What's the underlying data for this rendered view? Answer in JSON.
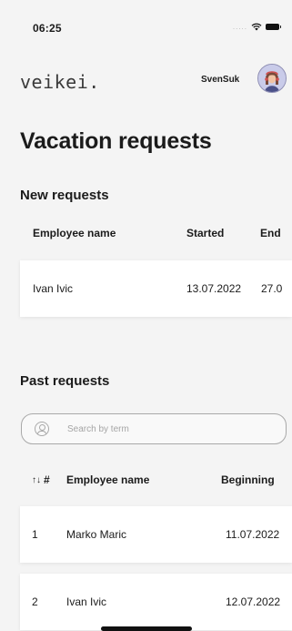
{
  "status_bar": {
    "time": "06:25",
    "signal": "....."
  },
  "header": {
    "logo": "veikei.",
    "username": "SvenSuk"
  },
  "page_title": "Vacation requests",
  "new_requests": {
    "title": "New requests",
    "columns": [
      "Employee name",
      "Started",
      "End"
    ],
    "rows": [
      {
        "employee": "Ivan Ivic",
        "started": "13.07.2022",
        "end": "27.0"
      }
    ]
  },
  "past_requests": {
    "title": "Past requests",
    "search": {
      "placeholder": "Search by term",
      "value": ""
    },
    "columns": {
      "sort": "↑↓",
      "number": "#",
      "employee": "Employee name",
      "beginning": "Beginning"
    },
    "rows": [
      {
        "number": "1",
        "employee": "Marko Maric",
        "beginning": "11.07.2022"
      },
      {
        "number": "2",
        "employee": "Ivan Ivic",
        "beginning": "12.07.2022"
      }
    ]
  },
  "icons": {
    "wifi": "wifi-icon",
    "battery": "battery-icon",
    "avatar": "avatar-icon",
    "search": "search-icon",
    "sort": "sort-icon"
  }
}
